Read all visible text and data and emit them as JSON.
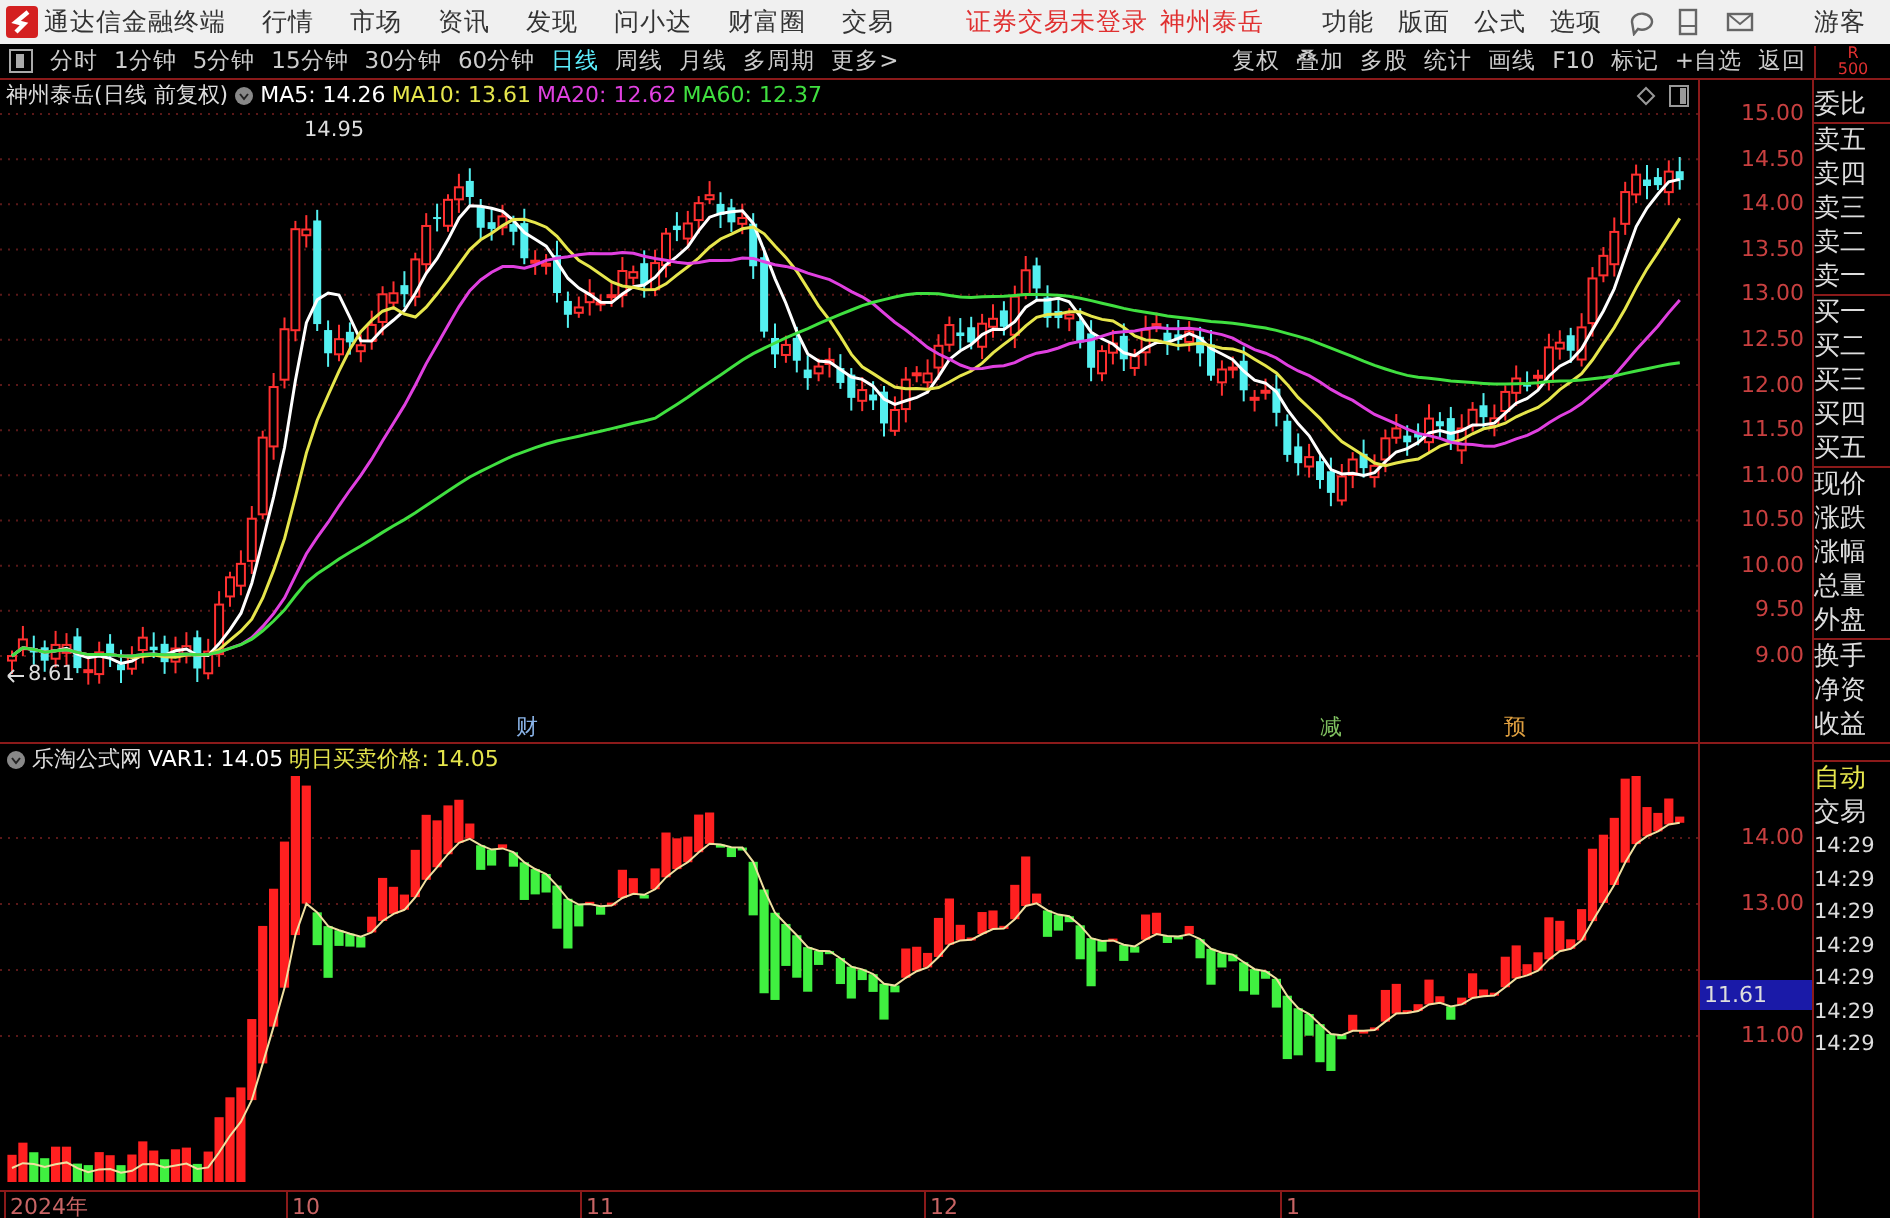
{
  "app": {
    "title": "通达信金融终端"
  },
  "menu": [
    "行情",
    "市场",
    "资讯",
    "发现",
    "问小达",
    "财富圈",
    "交易"
  ],
  "status_text": "证券交易未登录",
  "status_stock": "神州泰岳",
  "right_menu": [
    "功能",
    "版面",
    "公式",
    "选项"
  ],
  "user": "游客",
  "periods": [
    {
      "label": "分时",
      "selected": false
    },
    {
      "label": "1分钟",
      "selected": false
    },
    {
      "label": "5分钟",
      "selected": false
    },
    {
      "label": "15分钟",
      "selected": false
    },
    {
      "label": "30分钟",
      "selected": false
    },
    {
      "label": "60分钟",
      "selected": false
    },
    {
      "label": "日线",
      "selected": true
    },
    {
      "label": "周线",
      "selected": false
    },
    {
      "label": "月线",
      "selected": false
    },
    {
      "label": "多周期",
      "selected": false
    },
    {
      "label": "更多>",
      "selected": false
    }
  ],
  "tools": [
    "复权",
    "叠加",
    "多股",
    "统计",
    "画线",
    "F10",
    "标记",
    "+自选",
    "返回"
  ],
  "corner": {
    "line1": "R",
    "line2": "500"
  },
  "price_chart": {
    "title": "神州泰岳(日线 前复权)",
    "indicators": [
      {
        "label": "MA5: 14.26",
        "color": "#ffffff"
      },
      {
        "label": "MA10: 13.61",
        "color": "#e6e64c"
      },
      {
        "label": "MA20: 12.62",
        "color": "#e040e0"
      },
      {
        "label": "MA60: 12.37",
        "color": "#40e040"
      }
    ],
    "y_ticks": [
      "15.00",
      "14.50",
      "14.00",
      "13.50",
      "13.00",
      "12.50",
      "12.00",
      "11.50",
      "11.00",
      "10.50",
      "10.00",
      "9.50",
      "9.00"
    ],
    "high_label": "14.95",
    "low_label": "8.61",
    "event_markers": [
      {
        "label": "财",
        "color": "#8ab4e8"
      },
      {
        "label": "减",
        "color": "#7fc060"
      },
      {
        "label": "预",
        "color": "#e0a040"
      }
    ]
  },
  "indicator_panel": {
    "name": "乐淘公式网",
    "values": [
      {
        "label": "VAR1: 14.05",
        "color": "#ffffff"
      },
      {
        "label": "明日买卖价格: 14.05",
        "color": "#e6e64c"
      }
    ],
    "y_ticks": [
      "14.00",
      "13.00",
      "11.00"
    ],
    "current_value": "11.61"
  },
  "side_panel": {
    "quote_groups": [
      [
        "委比"
      ],
      [
        "卖五",
        "卖四",
        "卖三",
        "卖二",
        "卖一"
      ],
      [
        "买一",
        "买二",
        "买三",
        "买四",
        "买五"
      ],
      [
        "现价",
        "涨跌",
        "涨幅",
        "总量",
        "外盘"
      ],
      [
        "换手",
        "净资",
        "收益"
      ]
    ],
    "trade_header": [
      "自动",
      "交易"
    ],
    "trade_times": [
      "14:29",
      "14:29",
      "14:29",
      "14:29",
      "14:29",
      "14:29",
      "14:29"
    ]
  },
  "date_axis": [
    "2024年",
    "10",
    "11",
    "12",
    "1"
  ]
}
